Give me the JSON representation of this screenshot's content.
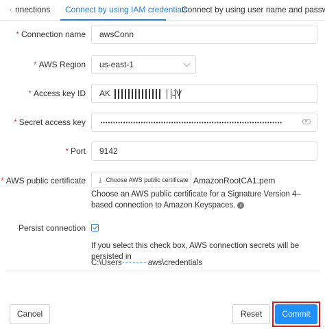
{
  "tabs": {
    "items": [
      {
        "label": "nnections",
        "active": false
      },
      {
        "label": "Connect by using IAM credentials",
        "active": true
      },
      {
        "label": "Connect by using user name and password",
        "active": false
      }
    ],
    "scroll_left_icon": "chevron-left-icon"
  },
  "form": {
    "connection_name": {
      "label": "Connection name",
      "value": "awsConn"
    },
    "aws_region": {
      "label": "AWS Region",
      "value": "us-east-1"
    },
    "access_key_id": {
      "label": "Access key ID",
      "value_prefix": "AK",
      "value_suffix": "JV"
    },
    "secret_access_key": {
      "label": "Secret access key",
      "value": "••••••••••••••••••••••••••••••••••••••••"
    },
    "port": {
      "label": "Port",
      "value": "9142"
    },
    "certificate": {
      "label": "AWS public certificate",
      "button_label": "Choose AWS public certificate",
      "file_name": "AmazonRootCA1.pem",
      "help_text": "Choose an AWS public certificate for a Signature Version 4–based connection to Amazon Keyspaces."
    },
    "persist": {
      "label": "Persist connection",
      "checked": true,
      "help_text": "If you select this check box, AWS connection secrets will be persisted in",
      "path_prefix": "C:\\Users",
      "path_suffix": "aws\\credentials"
    }
  },
  "footer": {
    "cancel_label": "Cancel",
    "reset_label": "Reset",
    "commit_label": "Commit"
  },
  "colors": {
    "accent": "#1f7ed8",
    "primary_button": "#1f8fff",
    "required": "#e5484d",
    "highlight_box": "#d7191c"
  }
}
